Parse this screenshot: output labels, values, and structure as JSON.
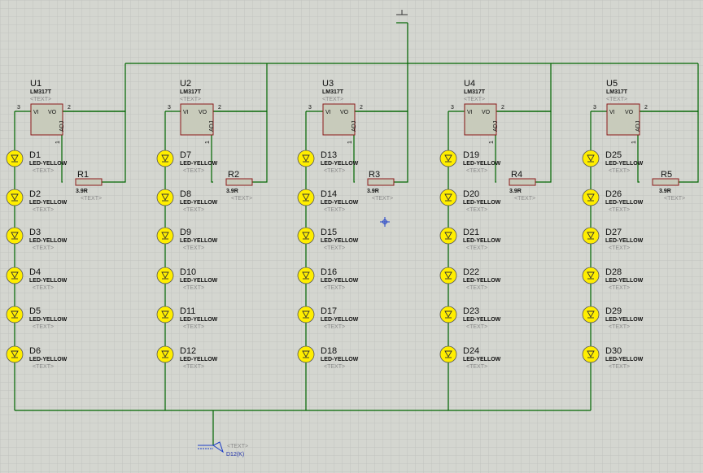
{
  "regulators": [
    {
      "ref": "U1",
      "part": "LM317T",
      "text": "<TEXT>",
      "pin_in": "3",
      "pin_out": "2",
      "pin_adj": "1",
      "label_vi": "VI",
      "label_vo": "VO",
      "label_adj": "ADJ"
    },
    {
      "ref": "U2",
      "part": "LM317T",
      "text": "<TEXT>",
      "pin_in": "3",
      "pin_out": "2",
      "pin_adj": "1",
      "label_vi": "VI",
      "label_vo": "VO",
      "label_adj": "ADJ"
    },
    {
      "ref": "U3",
      "part": "LM317T",
      "text": "<TEXT>",
      "pin_in": "3",
      "pin_out": "2",
      "pin_adj": "1",
      "label_vi": "VI",
      "label_vo": "VO",
      "label_adj": "ADJ"
    },
    {
      "ref": "U4",
      "part": "LM317T",
      "text": "<TEXT>",
      "pin_in": "3",
      "pin_out": "2",
      "pin_adj": "1",
      "label_vi": "VI",
      "label_vo": "VO",
      "label_adj": "ADJ"
    },
    {
      "ref": "U5",
      "part": "LM317T",
      "text": "<TEXT>",
      "pin_in": "3",
      "pin_out": "2",
      "pin_adj": "1",
      "label_vi": "VI",
      "label_vo": "VO",
      "label_adj": "ADJ"
    }
  ],
  "resistors": [
    {
      "ref": "R1",
      "value": "3.9R",
      "text": "<TEXT>"
    },
    {
      "ref": "R2",
      "value": "3.9R",
      "text": "<TEXT>"
    },
    {
      "ref": "R3",
      "value": "3.9R",
      "text": "<TEXT>"
    },
    {
      "ref": "R4",
      "value": "3.9R",
      "text": "<TEXT>"
    },
    {
      "ref": "R5",
      "value": "3.9R",
      "text": "<TEXT>"
    }
  ],
  "leds": [
    [
      "D1",
      "D2",
      "D3",
      "D4",
      "D5",
      "D6"
    ],
    [
      "D7",
      "D8",
      "D9",
      "D10",
      "D11",
      "D12"
    ],
    [
      "D13",
      "D14",
      "D15",
      "D16",
      "D17",
      "D18"
    ],
    [
      "D19",
      "D20",
      "D21",
      "D22",
      "D23",
      "D24"
    ],
    [
      "D25",
      "D26",
      "D27",
      "D28",
      "D29",
      "D30"
    ]
  ],
  "led_type": "LED-YELLOW",
  "led_text": "<TEXT>",
  "probe": {
    "text": "<TEXT>",
    "label": "D12(K)"
  },
  "colors": {
    "background": "#d4d6d0",
    "grid": "#c2c4bf",
    "wire": "#006600",
    "component_outline": "#8b1a1a",
    "component_fill": "#c8cbbb",
    "led_fill": "#ffee00",
    "probe": "#1a3cc8"
  }
}
